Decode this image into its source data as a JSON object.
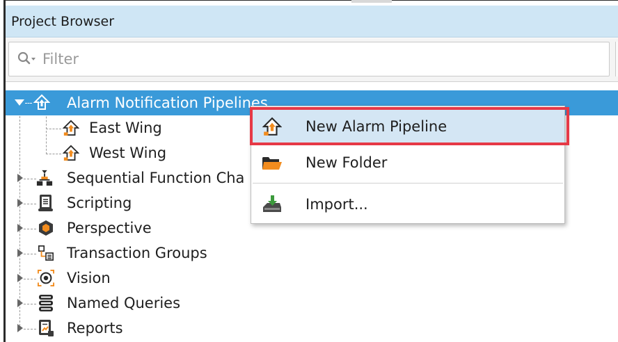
{
  "panel": {
    "title": "Project Browser"
  },
  "filter": {
    "placeholder": "Filter",
    "icon": "search-icon"
  },
  "tree": {
    "items": [
      {
        "label": "Alarm Notification Pipelines",
        "icon": "alarm-pipeline-icon",
        "expanded": true,
        "selected": true
      },
      {
        "label": "East Wing",
        "icon": "alarm-pipeline-icon",
        "child": true
      },
      {
        "label": "West Wing",
        "icon": "alarm-pipeline-icon",
        "child": true
      },
      {
        "label": "Sequential Function Cha",
        "icon": "sfc-icon"
      },
      {
        "label": "Scripting",
        "icon": "script-icon"
      },
      {
        "label": "Perspective",
        "icon": "perspective-icon"
      },
      {
        "label": "Transaction Groups",
        "icon": "transaction-groups-icon"
      },
      {
        "label": "Vision",
        "icon": "vision-icon"
      },
      {
        "label": "Named Queries",
        "icon": "named-queries-icon"
      },
      {
        "label": "Reports",
        "icon": "reports-icon"
      }
    ]
  },
  "context_menu": {
    "items": [
      {
        "label": "New Alarm Pipeline",
        "icon": "alarm-pipeline-icon",
        "highlighted": true
      },
      {
        "label": "New Folder",
        "icon": "folder-icon"
      },
      {
        "label": "Import...",
        "icon": "import-icon"
      }
    ]
  },
  "colors": {
    "selection": "#3a9ad9",
    "header": "#cfe6f5",
    "callout": "#e63946",
    "menu_hover": "#d4e6f4"
  }
}
